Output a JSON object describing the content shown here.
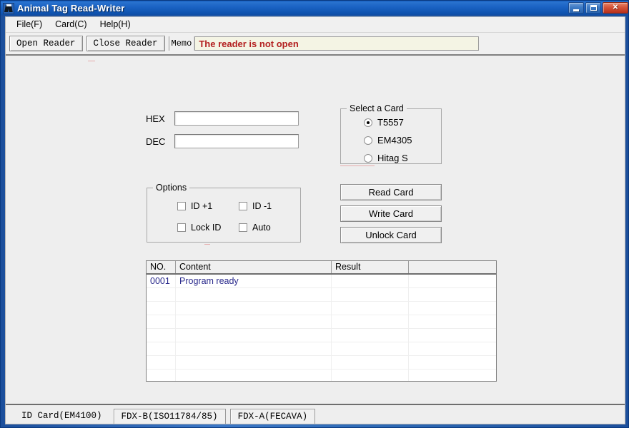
{
  "window": {
    "title": "Animal Tag Read-Writer",
    "icon": "animal-app-icon",
    "controls": {
      "minimize": "minimize-icon",
      "maximize": "maximize-icon",
      "close": "✕"
    }
  },
  "menu": {
    "items": [
      {
        "label": "File(F)"
      },
      {
        "label": "Card(C)"
      },
      {
        "label": "Help(H)"
      }
    ]
  },
  "toolbar": {
    "open_reader": "Open Reader",
    "close_reader": "Close Reader",
    "memo_label": "Memo",
    "memo_value": "The reader is not open",
    "memo_color": "#b32020"
  },
  "main": {
    "hex": {
      "label": "HEX",
      "value": "",
      "placeholder": ""
    },
    "dec": {
      "label": "DEC",
      "value": "",
      "placeholder": ""
    },
    "select_card": {
      "title": "Select a Card",
      "options": [
        {
          "label": "T5557",
          "selected": true
        },
        {
          "label": "EM4305",
          "selected": false
        },
        {
          "label": "Hitag S",
          "selected": false
        }
      ]
    },
    "options": {
      "title": "Options",
      "items": [
        {
          "label": "ID +1",
          "checked": false
        },
        {
          "label": "ID -1",
          "checked": false
        },
        {
          "label": "Lock ID",
          "checked": false
        },
        {
          "label": "Auto",
          "checked": false
        }
      ]
    },
    "actions": [
      {
        "label": "Read Card"
      },
      {
        "label": "Write Card"
      },
      {
        "label": "Unlock Card"
      }
    ],
    "grid": {
      "columns": [
        "NO.",
        "Content",
        "Result",
        ""
      ],
      "rows": [
        {
          "no": "0001",
          "content": "Program ready",
          "result": "",
          "extra": ""
        }
      ],
      "empty_row_count": 7,
      "text_color": "#2a2a8c"
    }
  },
  "tabs": [
    {
      "label": "ID Card(EM4100)",
      "active": true
    },
    {
      "label": "FDX-B(ISO11784/85)",
      "active": false
    },
    {
      "label": "FDX-A(FECAVA)",
      "active": false
    }
  ]
}
